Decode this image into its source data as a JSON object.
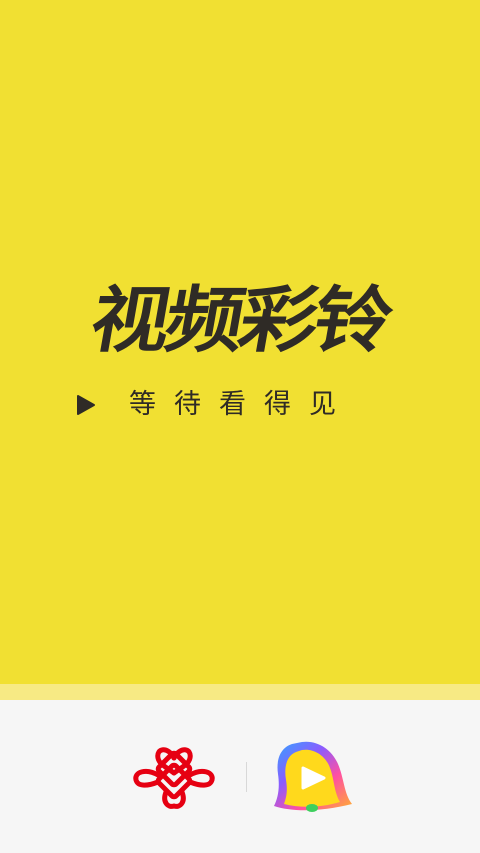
{
  "splash": {
    "title": "视频彩铃",
    "tagline": "等待看得见",
    "background_color": "#f1e032",
    "text_color": "#2f2b26"
  },
  "footer": {
    "background_color": "#f6f6f6",
    "logos": [
      {
        "name": "china-unicom-logo",
        "icon": "chinese-knot-icon",
        "color": "#e60012"
      },
      {
        "name": "video-ringtone-app-logo",
        "icon": "bell-play-icon"
      }
    ]
  }
}
